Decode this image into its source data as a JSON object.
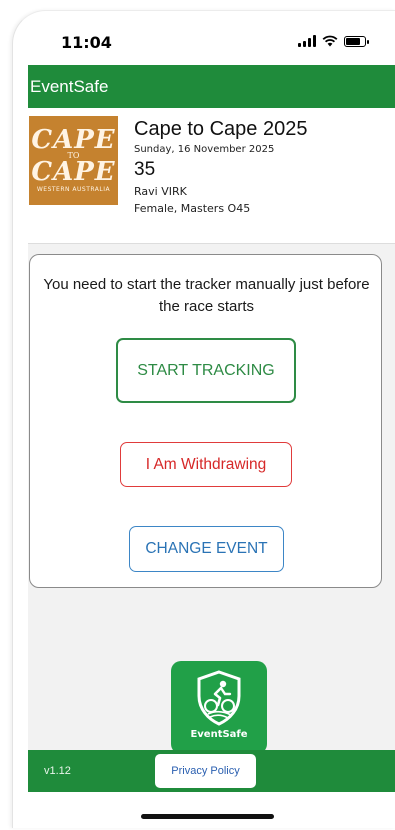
{
  "status_bar": {
    "time": "11:04"
  },
  "app_bar": {
    "title": "EventSafe"
  },
  "event": {
    "logo": {
      "line1": "CAPE",
      "connector": "TO",
      "line2": "CAPE",
      "subtitle": "WESTERN AUSTRALIA"
    },
    "name": "Cape to Cape 2025",
    "date": "Sunday, 16 November 2025",
    "bib": "35",
    "athlete_name": "Ravi VIRK",
    "category": "Female, Masters O45"
  },
  "card": {
    "message": "You need to start the tracker manually just before the race starts",
    "start_label": "START TRACKING",
    "withdraw_label": "I Am Withdrawing",
    "change_label": "CHANGE EVENT"
  },
  "brand": {
    "name": "EventSafe",
    "icon": "shield-cyclist-icon"
  },
  "footer": {
    "version": "v1.12",
    "privacy_label": "Privacy Policy"
  },
  "colors": {
    "primary_green": "#1f8b3b",
    "start_green": "#2e8b45",
    "withdraw_red": "#d62828",
    "change_blue": "#2a73b5",
    "logo_orange": "#c5822f"
  }
}
